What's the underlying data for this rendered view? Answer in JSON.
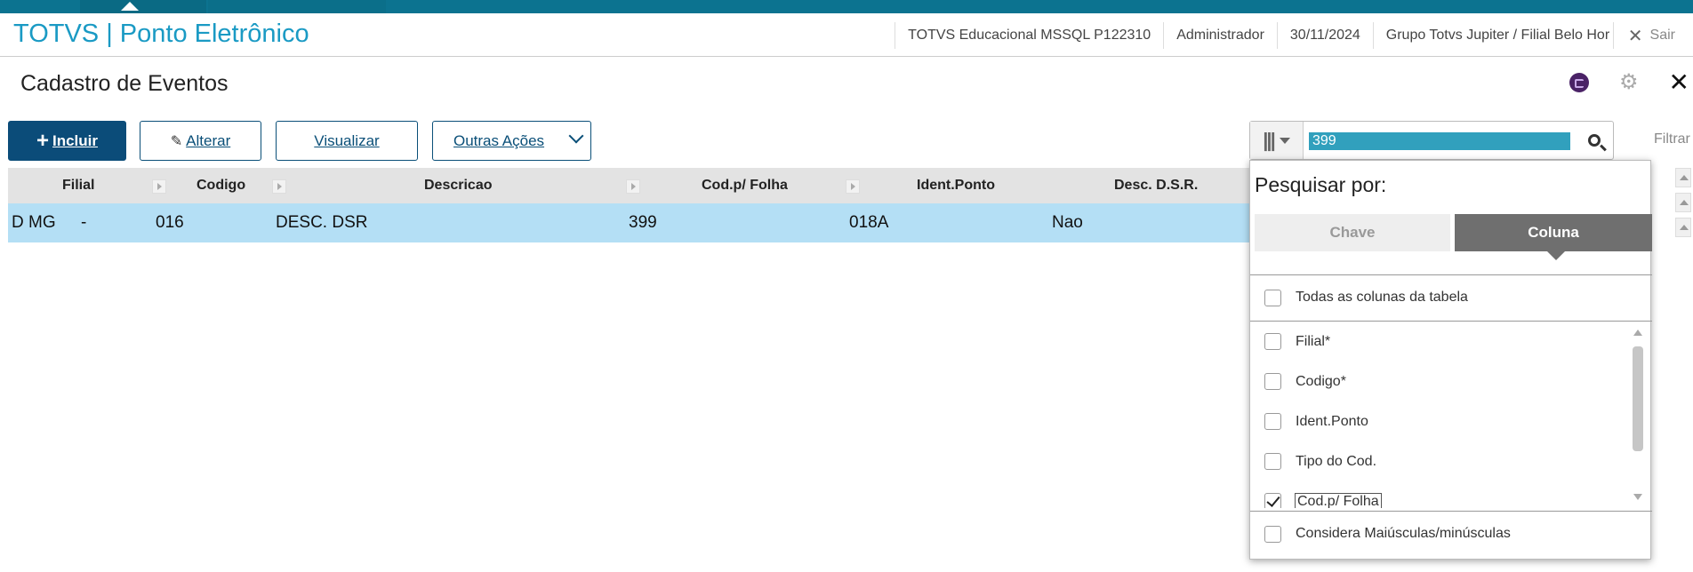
{
  "header": {
    "app_title": "TOTVS | Ponto Eletrônico",
    "environment": "TOTVS Educacional MSSQL P122310",
    "user": "Administrador",
    "date": "30/11/2024",
    "company": "Grupo Totvs Jupiter / Filial Belo Hor",
    "exit_label": "Sair"
  },
  "page": {
    "title": "Cadastro de Eventos",
    "icons": [
      "app-switch-icon",
      "gear-icon",
      "close-icon"
    ]
  },
  "toolbar": {
    "incluir_label": "Incluir",
    "alterar_label": "Alterar",
    "visualizar_label": "Visualizar",
    "outras_acoes_label": "Outras Ações"
  },
  "search": {
    "value": "399",
    "filter_label": "Filtrar"
  },
  "grid": {
    "columns": [
      "Filial",
      "Codigo",
      "Descricao",
      "Cod.p/ Folha",
      "Ident.Ponto",
      "Desc. D.S.R."
    ],
    "rows": [
      {
        "filial": "D MG",
        "sep": "-",
        "codigo": "016",
        "descricao": "DESC. DSR",
        "cod_folha": "399",
        "ident_ponto": "018A",
        "desc_dsr": "Nao"
      }
    ]
  },
  "search_popup": {
    "title": "Pesquisar por:",
    "tab_chave": "Chave",
    "tab_coluna": "Coluna",
    "all_columns_label": "Todas as colunas da tabela",
    "columns": [
      {
        "label": "Filial*",
        "checked": false
      },
      {
        "label": "Codigo*",
        "checked": false
      },
      {
        "label": "Ident.Ponto",
        "checked": false
      },
      {
        "label": "Tipo do Cod.",
        "checked": false
      },
      {
        "label": "Cod.p/ Folha",
        "checked": true
      }
    ],
    "case_label": "Considera Maiúsculas/minúsculas"
  },
  "colors": {
    "brand": "#1a9ac4",
    "primary_button": "#0b4c79",
    "selected_row": "#b4dff5",
    "top_strip": "#0c7390"
  }
}
